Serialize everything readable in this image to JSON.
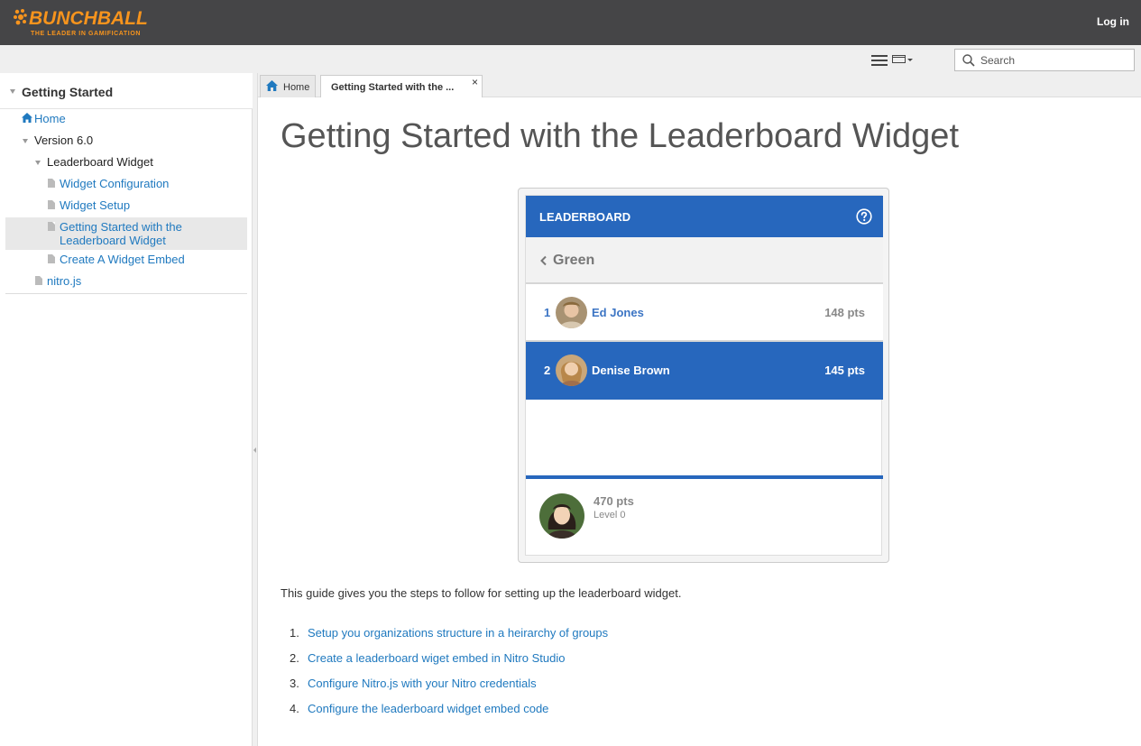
{
  "header": {
    "logo_text": "BUNCHBALL",
    "logo_tagline": "THE LEADER IN GAMIFICATION",
    "login_label": "Log in",
    "brand_color": "#f7941d"
  },
  "toolbar": {
    "search_placeholder": "Search"
  },
  "sidebar": {
    "title": "Getting Started",
    "items": [
      {
        "label": "Home"
      },
      {
        "label": "Version 6.0"
      },
      {
        "label": "Leaderboard Widget"
      },
      {
        "label": "Widget Configuration"
      },
      {
        "label": "Widget Setup"
      },
      {
        "label": "Getting Started with the",
        "label2": "Leaderboard Widget"
      },
      {
        "label": "Create A Widget Embed"
      },
      {
        "label": "nitro.js"
      }
    ]
  },
  "tabs": [
    {
      "label": "Home"
    },
    {
      "label": "Getting Started with the ...",
      "close": "×"
    }
  ],
  "main": {
    "title": "Getting Started with the Leaderboard Widget",
    "intro": "This guide gives you the steps to follow for setting up the leaderboard widget.",
    "steps": [
      {
        "num": "1.",
        "label": "Setup you organizations structure in a heirarchy of groups"
      },
      {
        "num": "2.",
        "label": "Create a leaderboard wiget embed in Nitro Studio"
      },
      {
        "num": "3.",
        "label": "Configure Nitro.js with your Nitro credentials"
      },
      {
        "num": "4.",
        "label": "Configure the leaderboard widget embed code"
      }
    ]
  },
  "widget": {
    "title": "LEADERBOARD",
    "group": "Green",
    "accent_color": "#2767bd",
    "rows": [
      {
        "rank": "1",
        "name": "Ed Jones",
        "pts": "148 pts"
      },
      {
        "rank": "2",
        "name": "Denise Brown",
        "pts": "145 pts"
      }
    ],
    "me": {
      "pts": "470 pts",
      "level": "Level 0"
    }
  }
}
